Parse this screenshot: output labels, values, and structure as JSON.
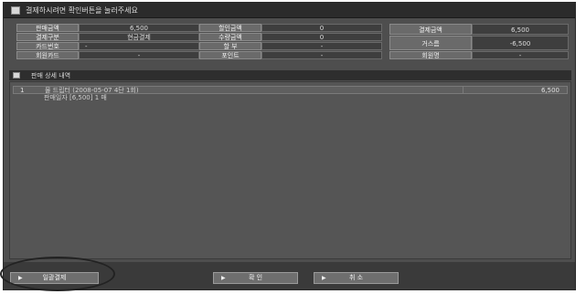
{
  "window": {
    "title": "결제하시려면 확인버튼을 눌러주세요"
  },
  "summary": {
    "rows": [
      [
        {
          "label": "판매금액",
          "value": "6,500"
        },
        {
          "label": "할인금액",
          "value": "0"
        }
      ],
      [
        {
          "label": "결제구분",
          "value": "현금결제"
        },
        {
          "label": "수량금액",
          "value": "0"
        }
      ],
      [
        {
          "label": "카드번호",
          "value": "-"
        },
        {
          "label": "할 부",
          "value": "-"
        }
      ],
      [
        {
          "label": "회원카드",
          "value": "-"
        },
        {
          "label": "포인트",
          "value": "-"
        }
      ]
    ],
    "right": [
      {
        "label": "결제금액",
        "value": "6,500"
      },
      {
        "label": "거스름",
        "value": "-6,500"
      },
      {
        "label": "회원명",
        "value": "-"
      }
    ]
  },
  "detail": {
    "header": "판매 상세 내역",
    "rows": [
      {
        "num": "1",
        "line1": "물 드립터 (2008-05-07 4단 1회)",
        "line2": "판매일자 [6,500] 1 매",
        "amount": "6,500"
      }
    ]
  },
  "buttons": {
    "reprint": "일괄결제",
    "confirm": "확 인",
    "cancel": "취 소"
  },
  "colors": {
    "window_bg": "#4e4e4e",
    "titlebar_bg": "#2b2b2b",
    "label_cell_bg": "#6a6a6a",
    "value_cell_bg": "#3e3e3e",
    "button_bg": "#6e6e6e"
  }
}
